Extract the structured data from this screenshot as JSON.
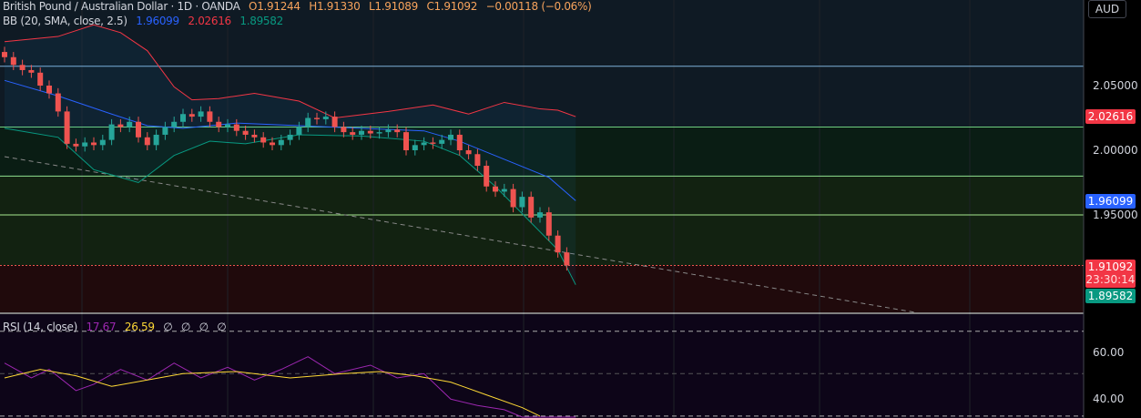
{
  "header": {
    "symbol": "British Pound / Australian Dollar · 1D · OANDA",
    "open": "O1.91244",
    "high": "H1.91330",
    "low": "L1.91089",
    "close": "C1.91092",
    "change": "−0.00118 (−0.06%)"
  },
  "bb": {
    "label": "BB (20, SMA, close, 2.5)",
    "basis": "1.96099",
    "upper": "2.02616",
    "lower": "1.89582"
  },
  "rsi": {
    "label": "RSI (14, close)",
    "value": "17.67",
    "ma": "26.59",
    "empty": [
      "∅",
      "∅",
      "∅",
      "∅"
    ]
  },
  "price_axis": {
    "currency": "AUD",
    "ticks": [
      "2.05000",
      "2.00000",
      "1.95000"
    ],
    "rsi_ticks": [
      "60.00",
      "40.00"
    ],
    "last_price": "1.91092",
    "countdown": "23:30:14",
    "upper_tag": "2.02616",
    "basis_tag": "1.96099",
    "lower_tag": "1.89582"
  },
  "colors": {
    "up": "#26a69a",
    "down": "#ef5350",
    "upper": "#f23645",
    "basis": "#2962ff",
    "lower": "#089981",
    "rsi": "#9c27b0",
    "rsima": "#fdd835"
  },
  "chart_data": {
    "type": "candlestick",
    "closes": [
      2.072,
      2.066,
      2.062,
      2.06,
      2.05,
      2.044,
      2.03,
      2.005,
      2.003,
      2.006,
      2.004,
      2.008,
      2.02,
      2.018,
      2.022,
      2.01,
      2.004,
      2.012,
      2.018,
      2.022,
      2.028,
      2.026,
      2.03,
      2.022,
      2.018,
      2.02,
      2.015,
      2.012,
      2.01,
      2.006,
      2.004,
      2.008,
      2.012,
      2.018,
      2.025,
      2.024,
      2.026,
      2.018,
      2.014,
      2.012,
      2.015,
      2.013,
      2.014,
      2.016,
      2.014,
      2.0,
      2.004,
      2.006,
      2.005,
      2.008,
      2.012,
      2.0,
      1.997,
      1.988,
      1.972,
      1.968,
      1.97,
      1.956,
      1.964,
      1.948,
      1.952,
      1.934,
      1.921,
      1.911
    ],
    "bb_upper": [
      [
        0,
        2.084
      ],
      [
        6,
        2.088
      ],
      [
        10,
        2.097
      ],
      [
        13,
        2.091
      ],
      [
        16,
        2.077
      ],
      [
        19,
        2.049
      ],
      [
        21,
        2.039
      ],
      [
        24,
        2.04
      ],
      [
        28,
        2.044
      ],
      [
        33,
        2.038
      ],
      [
        37,
        2.025
      ],
      [
        43,
        2.03
      ],
      [
        48,
        2.035
      ],
      [
        52,
        2.028
      ],
      [
        56,
        2.037
      ],
      [
        60,
        2.032
      ],
      [
        62,
        2.031
      ],
      [
        64,
        2.026
      ]
    ],
    "bb_basis": [
      [
        0,
        2.054
      ],
      [
        6,
        2.042
      ],
      [
        12,
        2.028
      ],
      [
        16,
        2.019
      ],
      [
        20,
        2.017
      ],
      [
        26,
        2.021
      ],
      [
        33,
        2.019
      ],
      [
        40,
        2.017
      ],
      [
        47,
        2.015
      ],
      [
        51,
        2.007
      ],
      [
        56,
        1.993
      ],
      [
        61,
        1.979
      ],
      [
        64,
        1.961
      ]
    ],
    "bb_lower": [
      [
        0,
        2.017
      ],
      [
        6,
        2.01
      ],
      [
        10,
        1.985
      ],
      [
        15,
        1.975
      ],
      [
        19,
        1.996
      ],
      [
        23,
        2.007
      ],
      [
        27,
        2.005
      ],
      [
        33,
        2.012
      ],
      [
        40,
        2.011
      ],
      [
        47,
        2.007
      ],
      [
        51,
        1.996
      ],
      [
        55,
        1.972
      ],
      [
        59,
        1.944
      ],
      [
        62,
        1.923
      ],
      [
        64,
        1.896
      ]
    ],
    "levels": [
      2.065,
      2.018,
      1.98,
      1.95,
      1.91092
    ],
    "rsi": [
      [
        0,
        55
      ],
      [
        3,
        48
      ],
      [
        5,
        52
      ],
      [
        8,
        42
      ],
      [
        10,
        45
      ],
      [
        13,
        52
      ],
      [
        16,
        47
      ],
      [
        19,
        55
      ],
      [
        22,
        48
      ],
      [
        25,
        53
      ],
      [
        28,
        47
      ],
      [
        31,
        52
      ],
      [
        34,
        58
      ],
      [
        37,
        50
      ],
      [
        41,
        54
      ],
      [
        44,
        48
      ],
      [
        47,
        50
      ],
      [
        50,
        38
      ],
      [
        53,
        35
      ],
      [
        56,
        33
      ],
      [
        58,
        28
      ],
      [
        60,
        25
      ],
      [
        62,
        20
      ],
      [
        64,
        17.67
      ]
    ],
    "rsi_ma": [
      [
        0,
        48
      ],
      [
        4,
        52
      ],
      [
        8,
        49
      ],
      [
        12,
        44
      ],
      [
        16,
        47
      ],
      [
        20,
        50
      ],
      [
        26,
        51
      ],
      [
        32,
        48
      ],
      [
        38,
        50
      ],
      [
        42,
        51
      ],
      [
        46,
        49
      ],
      [
        50,
        46
      ],
      [
        54,
        40
      ],
      [
        58,
        34
      ],
      [
        60,
        30
      ]
    ],
    "rsi_levels": [
      70,
      50,
      30
    ]
  }
}
